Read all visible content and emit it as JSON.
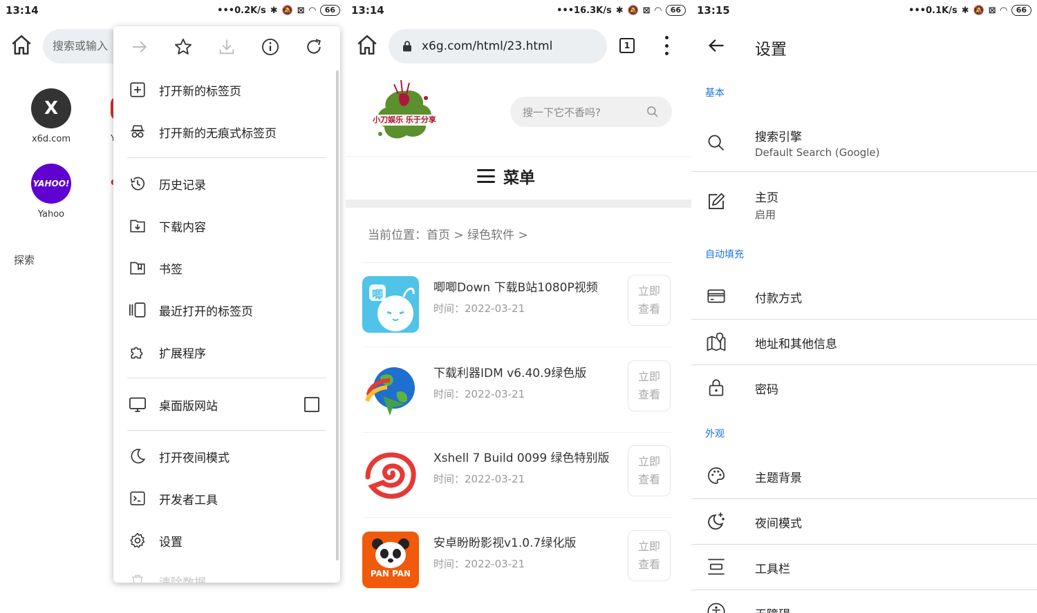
{
  "panel1": {
    "status": {
      "time": "13:14",
      "speed": "0.2K/s",
      "battery": "66"
    },
    "omnibox_placeholder": "搜索或输入",
    "tiles": [
      {
        "initial": "X",
        "label": "x6d.com"
      },
      {
        "initial": "YAHOO!",
        "label": "Yahoo"
      }
    ],
    "peek": {
      "y": "Y",
      "e": "e"
    },
    "explore": "探索",
    "menu": {
      "items": [
        "打开新的标签页",
        "打开新的无痕式标签页",
        "历史记录",
        "下载内容",
        "书签",
        "最近打开的标签页",
        "扩展程序",
        "桌面版网站",
        "打开夜间模式",
        "开发者工具",
        "设置",
        "清除数据"
      ]
    }
  },
  "panel2": {
    "status": {
      "time": "13:14",
      "speed": "16.3K/s",
      "battery": "66"
    },
    "url": "x6g.com/html/23.html",
    "tab_count": "1",
    "logo_text": "小刀娱乐 乐于分享",
    "search_placeholder": "搜一下它不香吗?",
    "menu_label": "菜单",
    "breadcrumb": "当前位置：首页 > 绿色软件 >",
    "posts": [
      {
        "title": "唧唧Down 下载B站1080P视频",
        "date": "时间：2022-03-21"
      },
      {
        "title": "下载利器IDM v6.40.9绿色版",
        "date": "时间：2022-03-21"
      },
      {
        "title": "Xshell 7 Build 0099 绿色特别版",
        "date": "时间：2022-03-21"
      },
      {
        "title": "安卓盼盼影视v1.0.7绿化版",
        "date": "时间：2022-03-21"
      }
    ],
    "action_line1": "立即",
    "action_line2": "查看",
    "thumb_text_0": "唧",
    "thumb_text_3": "PAN PAN"
  },
  "panel3": {
    "status": {
      "time": "13:15",
      "speed": "0.1K/s",
      "battery": "66"
    },
    "title": "设置",
    "sections": {
      "basic": "基本",
      "autofill": "自动填充",
      "appearance": "外观"
    },
    "items": {
      "search_engine": {
        "title": "搜索引擎",
        "sub": "Default Search (Google)"
      },
      "homepage": {
        "title": "主页",
        "sub": "启用"
      },
      "payment": {
        "title": "付款方式"
      },
      "address": {
        "title": "地址和其他信息"
      },
      "password": {
        "title": "密码"
      },
      "theme": {
        "title": "主题背景"
      },
      "night": {
        "title": "夜间模式"
      },
      "toolbar": {
        "title": "工具栏"
      },
      "accessibility": {
        "title": "无障碍"
      }
    }
  },
  "colors": {
    "accent": "#1a73e8",
    "x_tile": "#333333",
    "yahoo": "#5f01d1",
    "panpan": "#f05a0a",
    "jijidown": "#4fc3e8"
  }
}
